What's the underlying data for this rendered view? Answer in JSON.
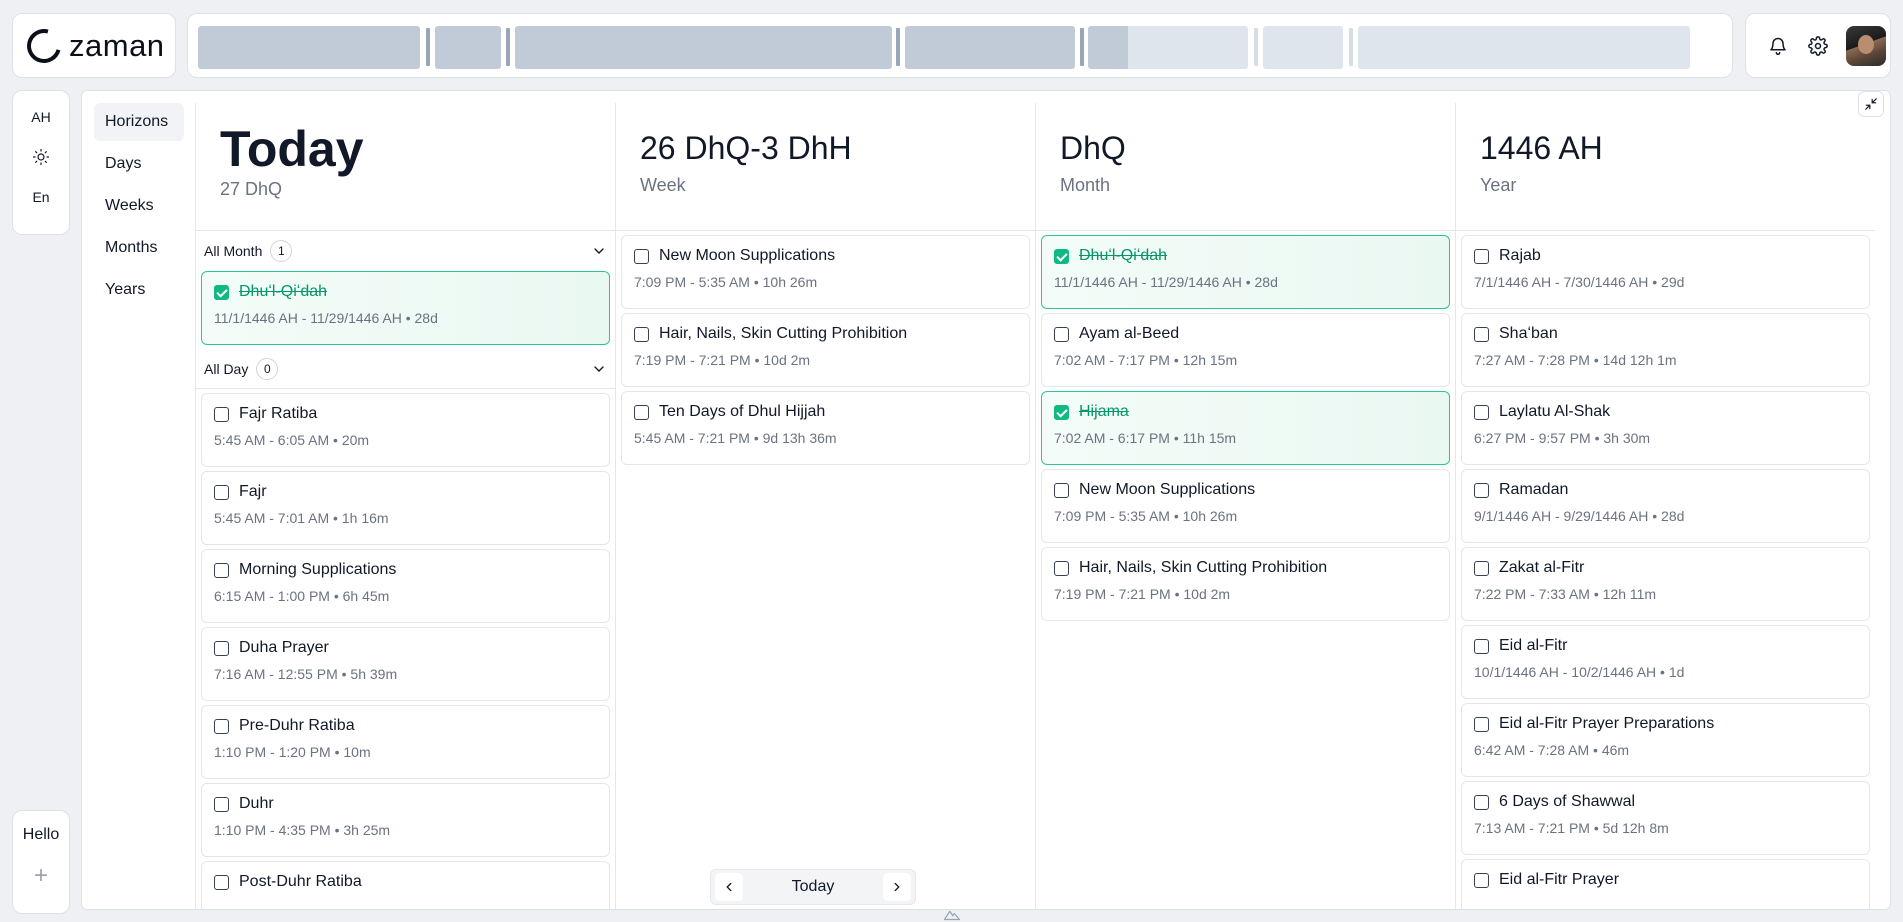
{
  "app": {
    "logo_text": "zaman"
  },
  "timeline": {
    "segments": [
      "dark",
      "dark",
      "dark",
      "dark",
      "dark",
      "light",
      "light",
      "light"
    ]
  },
  "actions": {
    "icons": [
      "bell-icon",
      "gear-icon"
    ]
  },
  "rail": {
    "calendar_label": "AH",
    "theme_icon": "sun-icon",
    "language_label": "En",
    "greeting": "Hello",
    "add_label": "+"
  },
  "nav": {
    "items": [
      "Horizons",
      "Days",
      "Weeks",
      "Months",
      "Years"
    ],
    "active": "Horizons"
  },
  "columns": {
    "today": {
      "title": "Today",
      "subtitle": "27 DhQ",
      "all_month_label": "All Month",
      "all_month_count": "1",
      "all_day_label": "All Day",
      "all_day_count": "0",
      "month_events": [
        {
          "title": "Dhuʻl-Qiʻdah",
          "meta": "11/1/1446 AH - 11/29/1446 AH • 28d",
          "done": true
        }
      ],
      "events": [
        {
          "title": "Fajr Ratiba",
          "meta": "5:45 AM - 6:05 AM • 20m",
          "done": false
        },
        {
          "title": "Fajr",
          "meta": "5:45 AM - 7:01 AM • 1h 16m",
          "done": false
        },
        {
          "title": "Morning Supplications",
          "meta": "6:15 AM - 1:00 PM • 6h 45m",
          "done": false
        },
        {
          "title": "Duha Prayer",
          "meta": "7:16 AM - 12:55 PM • 5h 39m",
          "done": false
        },
        {
          "title": "Pre-Duhr Ratiba",
          "meta": "1:10 PM - 1:20 PM • 10m",
          "done": false
        },
        {
          "title": "Duhr",
          "meta": "1:10 PM - 4:35 PM • 3h 25m",
          "done": false
        },
        {
          "title": "Post-Duhr Ratiba",
          "meta": "",
          "done": false
        }
      ]
    },
    "week": {
      "title": "26 DhQ-3 DhH",
      "subtitle": "Week",
      "events": [
        {
          "title": "New Moon Supplications",
          "meta": "7:09 PM - 5:35 AM • 10h 26m",
          "done": false
        },
        {
          "title": "Hair, Nails, Skin Cutting Prohibition",
          "meta": "7:19 PM - 7:21 PM • 10d 2m",
          "done": false
        },
        {
          "title": "Ten Days of Dhul Hijjah",
          "meta": "5:45 AM - 7:21 PM • 9d 13h 36m",
          "done": false
        }
      ],
      "pager_label": "Today"
    },
    "month": {
      "title": "DhQ",
      "subtitle": "Month",
      "events": [
        {
          "title": "Dhuʻl-Qiʻdah",
          "meta": "11/1/1446 AH - 11/29/1446 AH • 28d",
          "done": true
        },
        {
          "title": "Ayam al-Beed",
          "meta": "7:02 AM - 7:17 PM • 12h 15m",
          "done": false
        },
        {
          "title": "Hijama",
          "meta": "7:02 AM - 6:17 PM • 11h 15m",
          "done": true
        },
        {
          "title": "New Moon Supplications",
          "meta": "7:09 PM - 5:35 AM • 10h 26m",
          "done": false
        },
        {
          "title": "Hair, Nails, Skin Cutting Prohibition",
          "meta": "7:19 PM - 7:21 PM • 10d 2m",
          "done": false
        }
      ]
    },
    "year": {
      "title": "1446 AH",
      "subtitle": "Year",
      "events": [
        {
          "title": "Rajab",
          "meta": "7/1/1446 AH - 7/30/1446 AH • 29d",
          "done": false
        },
        {
          "title": "Shaʻban",
          "meta": "7:27 AM - 7:28 PM • 14d 12h 1m",
          "done": false
        },
        {
          "title": "Laylatu Al-Shak",
          "meta": "6:27 PM - 9:57 PM • 3h 30m",
          "done": false
        },
        {
          "title": "Ramadan",
          "meta": "9/1/1446 AH - 9/29/1446 AH • 28d",
          "done": false
        },
        {
          "title": "Zakat al-Fitr",
          "meta": "7:22 PM - 7:33 AM • 12h 11m",
          "done": false
        },
        {
          "title": "Eid al-Fitr",
          "meta": "10/1/1446 AH - 10/2/1446 AH • 1d",
          "done": false
        },
        {
          "title": "Eid al-Fitr Prayer Preparations",
          "meta": "6:42 AM - 7:28 AM • 46m",
          "done": false
        },
        {
          "title": "6 Days of Shawwal",
          "meta": "7:13 AM - 7:21 PM • 5d 12h 8m",
          "done": false
        },
        {
          "title": "Eid al-Fitr Prayer",
          "meta": "",
          "done": false
        }
      ]
    }
  },
  "colors": {
    "accent_done": "#10b981",
    "text": "#111827",
    "muted": "#6b7280"
  }
}
